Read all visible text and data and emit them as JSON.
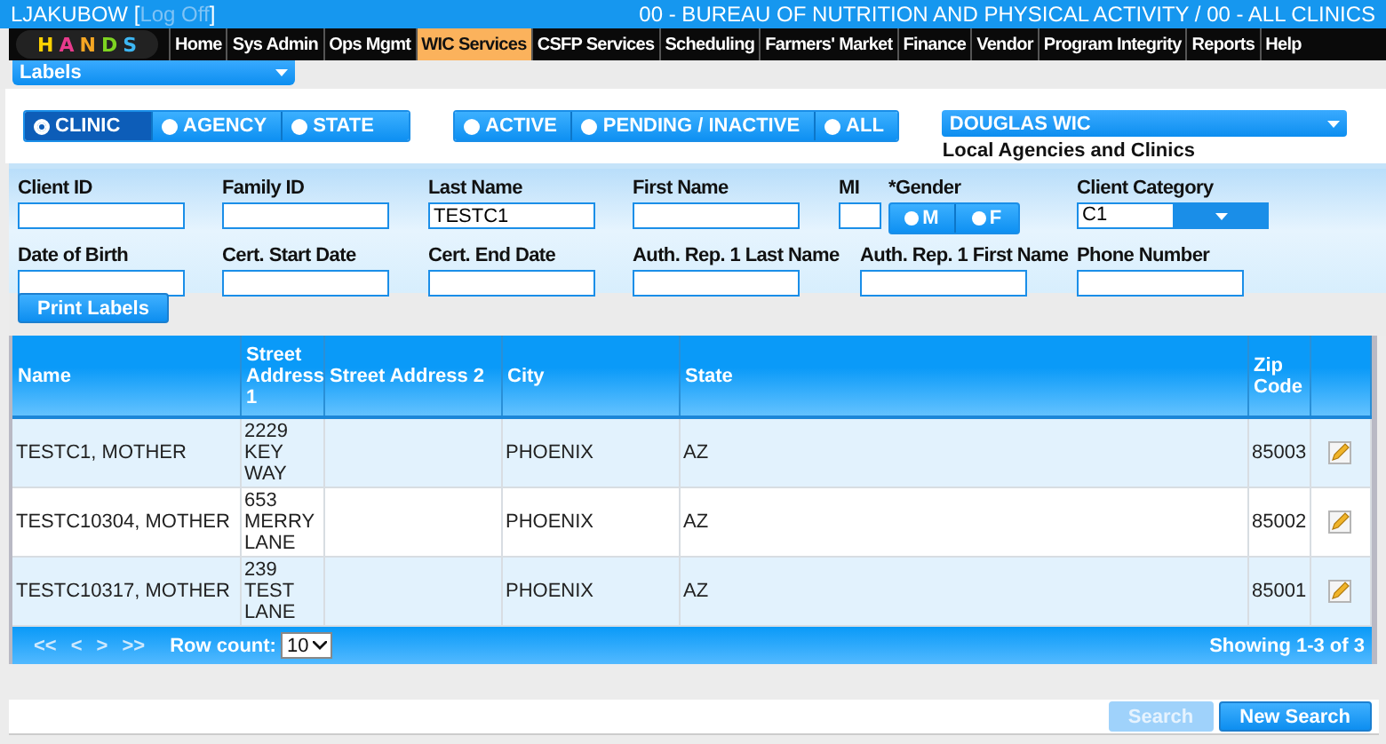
{
  "header": {
    "user": "LJAKUBOW",
    "brackets": [
      "[",
      "]"
    ],
    "logoff": "Log Off",
    "context": "00 - BUREAU OF NUTRITION AND PHYSICAL ACTIVITY / 00 - ALL CLINICS"
  },
  "logo": {
    "letters": [
      "H",
      "A",
      "N",
      "D",
      "S"
    ]
  },
  "menu": [
    {
      "label": "Home",
      "selected": false
    },
    {
      "label": "Sys Admin",
      "selected": false
    },
    {
      "label": "Ops Mgmt",
      "selected": false
    },
    {
      "label": "WIC Services",
      "selected": true
    },
    {
      "label": "CSFP Services",
      "selected": false
    },
    {
      "label": "Scheduling",
      "selected": false
    },
    {
      "label": "Farmers' Market",
      "selected": false
    },
    {
      "label": "Finance",
      "selected": false
    },
    {
      "label": "Vendor",
      "selected": false
    },
    {
      "label": "Program Integrity",
      "selected": false
    },
    {
      "label": "Reports",
      "selected": false
    },
    {
      "label": "Help",
      "selected": false
    }
  ],
  "page_select": {
    "value": "Labels"
  },
  "level_options": [
    {
      "label": "CLINIC",
      "selected": true
    },
    {
      "label": "AGENCY",
      "selected": false
    },
    {
      "label": "STATE",
      "selected": false
    }
  ],
  "status_options": [
    {
      "label": "ACTIVE",
      "selected": false
    },
    {
      "label": "PENDING / INACTIVE",
      "selected": false
    },
    {
      "label": "ALL",
      "selected": false
    }
  ],
  "agency": {
    "value": "DOUGLAS WIC",
    "caption": "Local Agencies and Clinics"
  },
  "form_rows": [
    [
      {
        "label": "Client ID",
        "kind": "text"
      },
      {
        "label": "Family ID",
        "kind": "text"
      },
      {
        "label": "Last Name",
        "kind": "text",
        "value": "TESTC1"
      },
      {
        "label": "First Name",
        "kind": "text"
      },
      {
        "label": "MI",
        "kind": "text"
      },
      {
        "label": "*Gender",
        "kind": "radio",
        "options": [
          {
            "label": "M",
            "selected": false
          },
          {
            "label": "F",
            "selected": false
          }
        ]
      },
      {
        "label": "Client Category",
        "kind": "select",
        "value": "C1"
      }
    ],
    [
      {
        "label": "Date of Birth",
        "kind": "text"
      },
      {
        "label": "Cert. Start Date",
        "kind": "text"
      },
      {
        "label": "Cert. End Date",
        "kind": "text"
      },
      {
        "label": "Auth. Rep. 1 Last Name",
        "kind": "text"
      },
      {
        "label": "Auth. Rep. 1 First Name",
        "kind": "text"
      },
      {
        "label": "Phone Number",
        "kind": "text"
      }
    ]
  ],
  "print_button": "Print Labels",
  "table": {
    "columns": [
      "Name",
      "Street Address 1",
      "Street Address 2",
      "City",
      "State",
      "Zip Code"
    ],
    "rows": [
      {
        "cells": [
          "TESTC1, MOTHER",
          "2229 KEY WAY",
          "",
          "PHOENIX",
          "AZ",
          "85003"
        ]
      },
      {
        "cells": [
          "TESTC10304, MOTHER",
          "653 MERRY LANE",
          "",
          "PHOENIX",
          "AZ",
          "85002"
        ]
      },
      {
        "cells": [
          "TESTC10317, MOTHER",
          "239 TEST LANE",
          "",
          "PHOENIX",
          "AZ",
          "85001"
        ]
      }
    ]
  },
  "pager": {
    "disabled": true,
    "first": "<<",
    "prev": "<",
    "next": ">",
    "last": ">>",
    "row_count_label": "Row count:",
    "row_count": "10",
    "summary": "Showing 1-3 of 3"
  },
  "buttons": [
    {
      "label": "Search",
      "disabled": true
    },
    {
      "label": "New Search",
      "disabled": false
    }
  ]
}
